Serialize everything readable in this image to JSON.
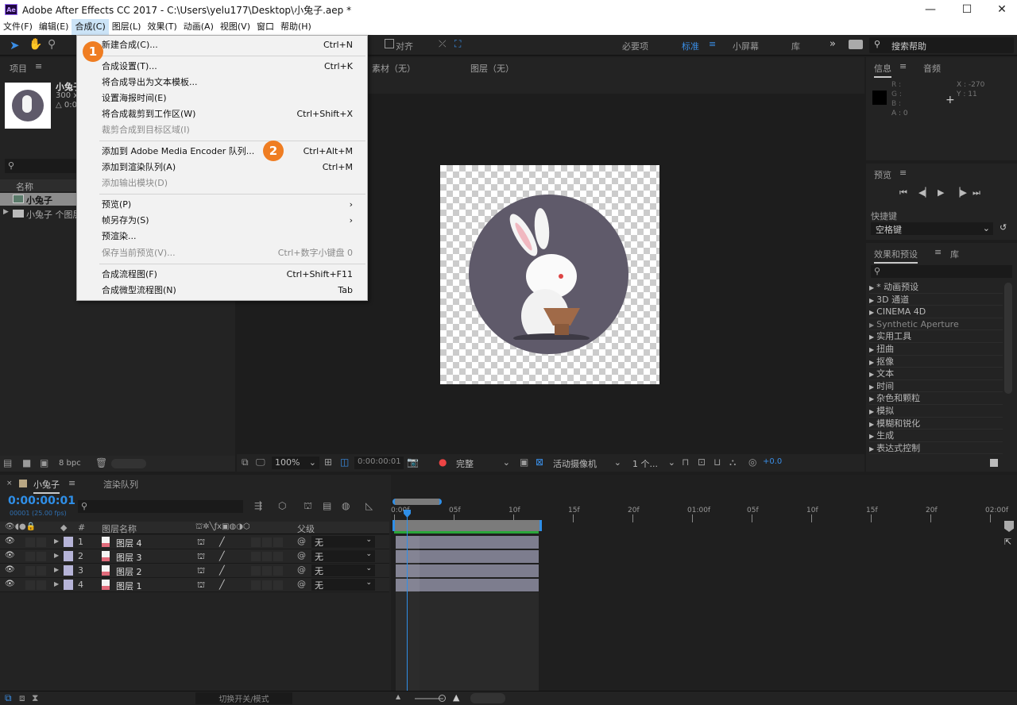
{
  "titlebar": {
    "app_icon": "Ae",
    "title": "Adobe After Effects CC 2017 - C:\\Users\\yelu177\\Desktop\\小兔子.aep *",
    "minimize": "—",
    "maximize": "☐",
    "close": "✕"
  },
  "menubar": [
    "文件(F)",
    "编辑(E)",
    "合成(C)",
    "图层(L)",
    "效果(T)",
    "动画(A)",
    "视图(V)",
    "窗口",
    "帮助(H)"
  ],
  "toolbar": {
    "align_label": "对齐",
    "workspaces": [
      "必要项",
      "标准",
      "小屏幕",
      "库"
    ],
    "active_workspace": "标准",
    "more": "»",
    "search_placeholder": "搜索帮助"
  },
  "comp_menu": {
    "items": [
      {
        "label": "新建合成(C)...",
        "shortcut": "Ctrl+N",
        "disabled": false
      },
      {
        "label": "合成设置(T)...",
        "shortcut": "Ctrl+K",
        "disabled": false
      },
      {
        "label": "将合成导出为文本模板...",
        "shortcut": "",
        "disabled": false
      },
      {
        "label": "设置海报时间(E)",
        "shortcut": "",
        "disabled": false
      },
      {
        "label": "将合成裁剪到工作区(W)",
        "shortcut": "Ctrl+Shift+X",
        "disabled": false
      },
      {
        "label": "裁剪合成到目标区域(I)",
        "shortcut": "",
        "disabled": true
      },
      {
        "label": "添加到 Adobe Media Encoder 队列...",
        "shortcut": "Ctrl+Alt+M",
        "disabled": false
      },
      {
        "label": "添加到渲染队列(A)",
        "shortcut": "Ctrl+M",
        "disabled": false
      },
      {
        "label": "添加输出模块(D)",
        "shortcut": "",
        "disabled": true
      },
      {
        "label": "预览(P)",
        "shortcut": "›",
        "disabled": false
      },
      {
        "label": "帧另存为(S)",
        "shortcut": "›",
        "disabled": false
      },
      {
        "label": "预渲染...",
        "shortcut": "",
        "disabled": false
      },
      {
        "label": "保存当前预览(V)...",
        "shortcut": "Ctrl+数字小键盘 0",
        "disabled": true
      },
      {
        "label": "合成流程图(F)",
        "shortcut": "Ctrl+Shift+F11",
        "disabled": false
      },
      {
        "label": "合成微型流程图(N)",
        "shortcut": "Tab",
        "disabled": false
      }
    ],
    "annotations": [
      "1",
      "2"
    ],
    "annotation_color": "#ef7d22"
  },
  "project": {
    "title": "项目",
    "comp_name": "小兔子",
    "comp_info1": "300 x",
    "comp_info2": "△ 0:0",
    "name_col": "名称",
    "items": [
      "小兔子",
      "小兔子 个图层"
    ],
    "bpc": "8 bpc"
  },
  "viewer": {
    "footage_tab": "素材（无）",
    "layer_tab": "图层（无）",
    "zoom": "100%",
    "timecode": "0:00:00:01",
    "resolution": "完整",
    "camera": "活动摄像机",
    "views": "1 个...",
    "exposure": "+0.0",
    "circle_color": "#5f5a6a"
  },
  "info": {
    "tab": "信息",
    "audio_tab": "音频",
    "r": "R :",
    "g": "G :",
    "b": "B :",
    "a": "A : 0",
    "x": "X : -270",
    "y": "Y : 11"
  },
  "preview": {
    "title": "预览",
    "shortcut_label": "快捷键",
    "shortcut_value": "空格键"
  },
  "effects": {
    "tab": "效果和预设",
    "lib_tab": "库",
    "items": [
      "* 动画预设",
      "3D 通道",
      "CINEMA 4D",
      "Synthetic Aperture",
      "实用工具",
      "扭曲",
      "抠像",
      "文本",
      "时间",
      "杂色和颗粒",
      "模拟",
      "模糊和锐化",
      "生成",
      "表达式控制"
    ]
  },
  "timeline": {
    "comp_tab": "小兔子",
    "render_tab": "渲染队列",
    "timecode": "0:00:00:01",
    "frame_info": "00001 (25.00 fps)",
    "col_num": "#",
    "col_name": "图层名称",
    "col_parent": "父级",
    "layers": [
      {
        "num": "1",
        "name": "图层 4",
        "parent": "无"
      },
      {
        "num": "2",
        "name": "图层 3",
        "parent": "无"
      },
      {
        "num": "3",
        "name": "图层 2",
        "parent": "无"
      },
      {
        "num": "4",
        "name": "图层 1",
        "parent": "无"
      }
    ],
    "ruler": [
      "0:00f",
      "05f",
      "10f",
      "15f",
      "20f",
      "01:00f",
      "05f",
      "10f",
      "15f",
      "20f",
      "02:00f"
    ],
    "toggle_label": "切换开关/模式",
    "accent": "#2f8fe8",
    "work_area_color": "#2aa63a"
  }
}
